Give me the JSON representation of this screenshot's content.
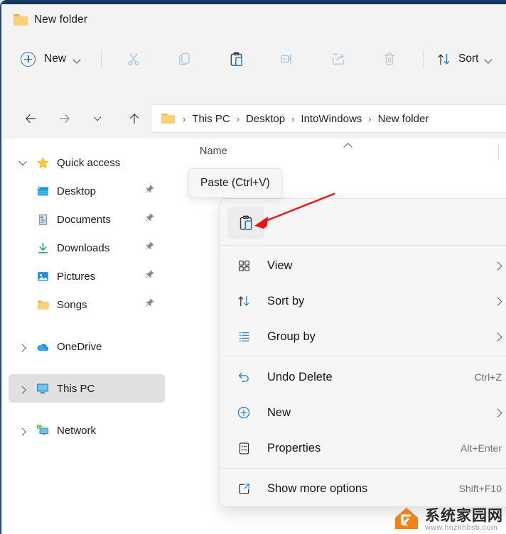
{
  "window": {
    "title": "New folder",
    "title_icon": "folder-icon"
  },
  "toolbar": {
    "new_label": "New",
    "new_icon": "plus-circle-icon",
    "new_chevron_icon": "chevron-down-icon",
    "buttons": [
      {
        "name": "cut",
        "icon": "scissors-icon",
        "enabled": false
      },
      {
        "name": "copy",
        "icon": "copy-icon",
        "enabled": false
      },
      {
        "name": "paste",
        "icon": "paste-icon",
        "enabled": true
      },
      {
        "name": "rename",
        "icon": "rename-icon",
        "enabled": false
      },
      {
        "name": "share",
        "icon": "share-icon",
        "enabled": false
      },
      {
        "name": "delete",
        "icon": "trash-icon",
        "enabled": false
      }
    ],
    "sort_label": "Sort",
    "sort_icon": "sort-arrows-icon",
    "sort_chevron_icon": "chevron-down-icon"
  },
  "navigation": {
    "back_icon": "arrow-left-icon",
    "forward_icon": "arrow-right-icon",
    "recent_icon": "chevron-down-icon",
    "up_icon": "arrow-up-icon"
  },
  "breadcrumb": {
    "folder_icon": "folder-icon",
    "separator": "›",
    "items": [
      {
        "label": "This PC"
      },
      {
        "label": "Desktop"
      },
      {
        "label": "IntoWindows"
      },
      {
        "label": "New folder"
      }
    ]
  },
  "sidebar": {
    "groups": [
      {
        "name": "quick-access",
        "label": "Quick access",
        "icon": "star-icon",
        "caret": "chevron-down-icon",
        "expanded": true,
        "children": [
          {
            "label": "Desktop",
            "icon": "desktop-icon",
            "pinned": true
          },
          {
            "label": "Documents",
            "icon": "documents-icon",
            "pinned": true
          },
          {
            "label": "Downloads",
            "icon": "downloads-icon",
            "pinned": true
          },
          {
            "label": "Pictures",
            "icon": "pictures-icon",
            "pinned": true
          },
          {
            "label": "Songs",
            "icon": "folder-icon",
            "pinned": true
          }
        ]
      },
      {
        "name": "onedrive",
        "label": "OneDrive",
        "icon": "cloud-icon",
        "caret": "chevron-right-icon",
        "expanded": false,
        "selected": false,
        "children": []
      },
      {
        "name": "this-pc",
        "label": "This PC",
        "icon": "monitor-icon",
        "caret": "chevron-right-icon",
        "expanded": false,
        "selected": true,
        "children": []
      },
      {
        "name": "network",
        "label": "Network",
        "icon": "network-icon",
        "caret": "chevron-right-icon",
        "expanded": false,
        "selected": false,
        "children": []
      }
    ]
  },
  "file_list": {
    "columns": [
      {
        "label": "Name",
        "sort_indicator": "chevron-up-icon"
      }
    ],
    "rows": []
  },
  "tooltip": {
    "text": "Paste (Ctrl+V)"
  },
  "context_menu": {
    "icon_row": [
      {
        "name": "paste",
        "icon": "paste-icon",
        "highlighted": true
      }
    ],
    "items": [
      {
        "label": "View",
        "icon": "grid-icon",
        "accel": "",
        "submenu": true
      },
      {
        "label": "Sort by",
        "icon": "sort-arrows-icon",
        "accel": "",
        "submenu": true
      },
      {
        "label": "Group by",
        "icon": "group-list-icon",
        "accel": "",
        "submenu": true
      },
      {
        "separator": true
      },
      {
        "label": "Undo Delete",
        "icon": "undo-icon",
        "accel": "Ctrl+Z",
        "submenu": false
      },
      {
        "label": "New",
        "icon": "plus-circle-icon",
        "accel": "",
        "submenu": true
      },
      {
        "label": "Properties",
        "icon": "properties-icon",
        "accel": "Alt+Enter",
        "submenu": false
      },
      {
        "separator": true
      },
      {
        "label": "Show more options",
        "icon": "expand-icon",
        "accel": "Shift+F10",
        "submenu": false
      }
    ]
  },
  "annotation": {
    "arrow_color": "#ee1111",
    "arrow_name": "red-pointer-arrow"
  },
  "watermark": {
    "brand_cn": "系统家园网",
    "url": "www.hnzkhbsb.com",
    "logo_color": "#f08218"
  },
  "colors": {
    "accent": "#2f6fb5",
    "window_bg": "#f3f3f3",
    "pane_bg": "#ffffff",
    "menu_bg": "#f6f6f6",
    "selected_row": "#e0e0e0"
  }
}
